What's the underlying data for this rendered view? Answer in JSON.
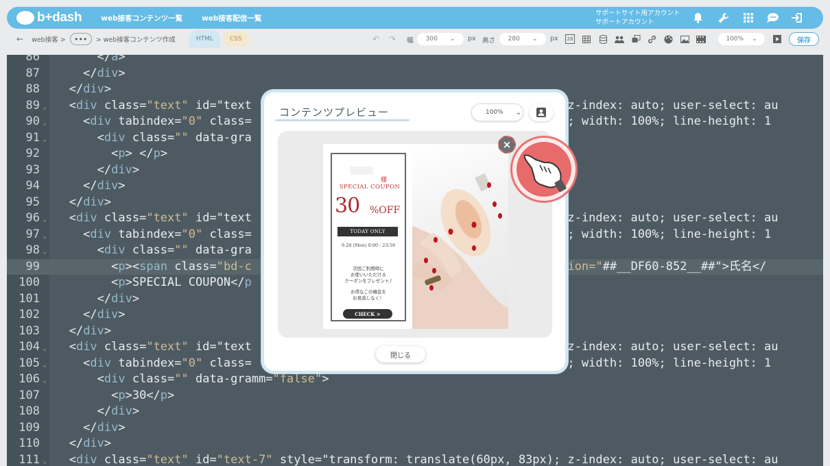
{
  "header": {
    "logo_text": "b+dash",
    "nav": [
      "web接客コンテンツ一覧",
      "web接客配信一覧"
    ],
    "account_line1": "サポートサイト用アカウント",
    "account_line2": "サポートアカウント",
    "icons": [
      "bell-icon",
      "wrench-icon",
      "grid-icon",
      "chat-icon",
      "logout-icon"
    ]
  },
  "toolbar": {
    "breadcrumb_root": "web接客 >",
    "breadcrumb_more": "•••",
    "breadcrumb_current": "> web接客コンテンツ作成",
    "tab_html": "HTML",
    "tab_css": "CSS",
    "width_label": "幅",
    "width_value": "300",
    "width_unit": "px",
    "height_label": "高さ",
    "height_value": "280",
    "height_unit": "px",
    "zoom_value": "100%",
    "save_label": "保存"
  },
  "editor": {
    "lines": [
      {
        "n": "86",
        "code": "      </a>"
      },
      {
        "n": "87",
        "code": "    </div>"
      },
      {
        "n": "88",
        "code": "  </div>"
      },
      {
        "n": "89",
        "code": "  <div class=\"text\" id=\"text                                         x); z-index: auto; user-select: au"
      },
      {
        "n": "90",
        "code": "    <div tabindex=\"0\" class=                                         100%; width: 100%; line-height: 1"
      },
      {
        "n": "91",
        "code": "      <div class=\"\" data-gra"
      },
      {
        "n": "92",
        "code": "        <p> </p>"
      },
      {
        "n": "93",
        "code": "      </div>"
      },
      {
        "n": "94",
        "code": "    </div>"
      },
      {
        "n": "95",
        "code": "  </div>"
      },
      {
        "n": "96",
        "code": "  <div class=\"text\" id=\"text                                         x); z-index: auto; user-select: au"
      },
      {
        "n": "97",
        "code": "    <div tabindex=\"0\" class=                                         100%; width: 100%; line-height: 1"
      },
      {
        "n": "98",
        "code": "      <div class=\"\" data-gra"
      },
      {
        "n": "99",
        "code": "        <p><span class=\"bd-c                                        nsertion=\"##__DF60-852__##\">氏名</"
      },
      {
        "n": "100",
        "code": "        <p>SPECIAL COUPON</p"
      },
      {
        "n": "101",
        "code": "      </div>"
      },
      {
        "n": "102",
        "code": "    </div>"
      },
      {
        "n": "103",
        "code": "  </div>"
      },
      {
        "n": "104",
        "code": "  <div class=\"text\" id=\"text                                         x); z-index: auto; user-select: au"
      },
      {
        "n": "105",
        "code": "    <div tabindex=\"0\" class=                                         100%; width: 100%; line-height: 1"
      },
      {
        "n": "106",
        "code": "      <div class=\"\" data-gramm=\"false\">"
      },
      {
        "n": "107",
        "code": "        <p>30</p>"
      },
      {
        "n": "108",
        "code": "      </div>"
      },
      {
        "n": "109",
        "code": "    </div>"
      },
      {
        "n": "110",
        "code": "  </div>"
      },
      {
        "n": "111",
        "code": "  <div class=\"text\" id=\"text-7\" style=\"transform: translate(60px, 83px); z-index: auto; user-select: au"
      }
    ],
    "highlight_line": "99"
  },
  "modal": {
    "title": "コンテンツプレビュー",
    "zoom": "100%",
    "close_label": "閉じる",
    "coupon": {
      "sama": "様",
      "special": "SPECIAL COUPON",
      "percent": "30",
      "off": "%OFF",
      "today_only": "TODAY ONLY",
      "date": "9.28 (Mon) 0:00 - 23:59",
      "msg1": [
        "次回ご利用時に",
        "お使いいただける",
        "クーポンをプレゼント♪"
      ],
      "msg2": [
        "お得なこの機会を",
        "お見逃しなく！"
      ],
      "check": "CHECK  >"
    }
  }
}
